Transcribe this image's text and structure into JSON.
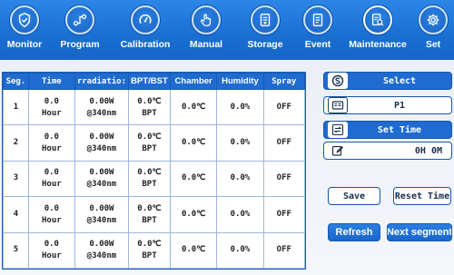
{
  "nav": [
    {
      "key": "monitor",
      "label": "Monitor",
      "icon": "shield-check-icon"
    },
    {
      "key": "program",
      "label": "Program",
      "icon": "flow-icon"
    },
    {
      "key": "calibration",
      "label": "Calibration",
      "icon": "gauge-icon"
    },
    {
      "key": "manual",
      "label": "Manual",
      "icon": "hand-pointer-icon"
    },
    {
      "key": "storage",
      "label": "Storage",
      "icon": "storage-file-icon"
    },
    {
      "key": "event",
      "label": "Event",
      "icon": "event-list-icon"
    },
    {
      "key": "maintenance",
      "label": "Maintenance",
      "icon": "maintenance-search-icon"
    },
    {
      "key": "set",
      "label": "Set",
      "icon": "settings-gear-icon"
    }
  ],
  "table": {
    "headers": [
      "Seg.",
      "Time",
      "rradiatio:",
      "BPT/BST",
      "Chamber",
      "Humidity",
      "Spray"
    ],
    "rows": [
      {
        "seg": "1",
        "time_value": "0.0",
        "time_unit": "Hour",
        "irr_value": "0.00W",
        "irr_wave": "@340nm",
        "bpt_value": "0.0℃",
        "bpt_unit": "BPT",
        "chamber": "0.0℃",
        "humidity": "0.0%",
        "spray": "OFF"
      },
      {
        "seg": "2",
        "time_value": "0.0",
        "time_unit": "Hour",
        "irr_value": "0.00W",
        "irr_wave": "@340nm",
        "bpt_value": "0.0℃",
        "bpt_unit": "BPT",
        "chamber": "0.0℃",
        "humidity": "0.0%",
        "spray": "OFF"
      },
      {
        "seg": "3",
        "time_value": "0.0",
        "time_unit": "Hour",
        "irr_value": "0.00W",
        "irr_wave": "@340nm",
        "bpt_value": "0.0℃",
        "bpt_unit": "BPT",
        "chamber": "0.0℃",
        "humidity": "0.0%",
        "spray": "OFF"
      },
      {
        "seg": "4",
        "time_value": "0.0",
        "time_unit": "Hour",
        "irr_value": "0.00W",
        "irr_wave": "@340nm",
        "bpt_value": "0.0℃",
        "bpt_unit": "BPT",
        "chamber": "0.0℃",
        "humidity": "0.0%",
        "spray": "OFF"
      },
      {
        "seg": "5",
        "time_value": "0.0",
        "time_unit": "Hour",
        "irr_value": "0.00W",
        "irr_wave": "@340nm",
        "bpt_value": "0.0℃",
        "bpt_unit": "BPT",
        "chamber": "0.0℃",
        "humidity": "0.0%",
        "spray": "OFF"
      }
    ]
  },
  "side": {
    "select_label": "Select",
    "select_icon": "circle-s-icon",
    "program_value": "P1",
    "program_icon": "id-card-icon",
    "set_time_label": "Set Time",
    "set_time_icon": "swap-arrows-icon",
    "time_value": "0H 0M",
    "time_icon": "edit-pen-icon",
    "save_label": "Save",
    "reset_time_label": "Reset Time",
    "refresh_label": "Refresh",
    "next_segment_label": "Next segment"
  },
  "colors": {
    "nav_bar": "#1a6fd1",
    "table_header": "#1f6bd0",
    "accent": "#1557af"
  }
}
